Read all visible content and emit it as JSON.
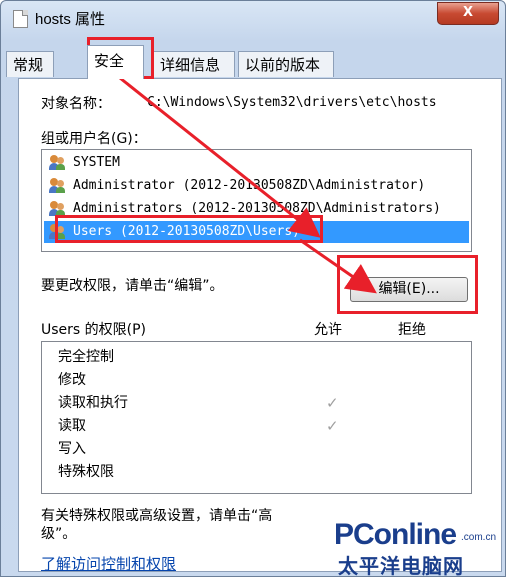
{
  "window": {
    "title": "hosts 属性",
    "close_label": "X"
  },
  "tabs": [
    {
      "label": "常规"
    },
    {
      "label": "安全"
    },
    {
      "label": "详细信息"
    },
    {
      "label": "以前的版本"
    }
  ],
  "object": {
    "label": "对象名称：",
    "value": "C:\\Windows\\System32\\drivers\\etc\\hosts"
  },
  "group_label": "组或用户名(G)：",
  "users": [
    {
      "name": "SYSTEM"
    },
    {
      "name": "Administrator (2012-20130508ZD\\Administrator)"
    },
    {
      "name": "Administrators (2012-20130508ZD\\Administrators)"
    },
    {
      "name": "Users (2012-20130508ZD\\Users)",
      "selected": true
    }
  ],
  "change_hint": "要更改权限，请单击“编辑”。",
  "edit_button": "编辑(E)...",
  "permissions": {
    "header": "Users 的权限(P)",
    "allow_label": "允许",
    "deny_label": "拒绝",
    "rows": [
      {
        "name": "完全控制",
        "allow": false,
        "deny": false
      },
      {
        "name": "修改",
        "allow": false,
        "deny": false
      },
      {
        "name": "读取和执行",
        "allow": true,
        "deny": false
      },
      {
        "name": "读取",
        "allow": true,
        "deny": false
      },
      {
        "name": "写入",
        "allow": false,
        "deny": false
      },
      {
        "name": "特殊权限",
        "allow": false,
        "deny": false
      }
    ],
    "check_glyph": "✓"
  },
  "special_hint_line1": "有关特殊权限或高级设置，请单击“高",
  "special_hint_line2": "级”。",
  "learn_link": "了解访问控制和权限",
  "watermark": {
    "brand": "PConline",
    "domain": ".com.cn",
    "sub": "太平洋电脑网"
  },
  "colors": {
    "annotation": "#e8202a",
    "selection": "#3399ff",
    "link": "#0645ad"
  }
}
